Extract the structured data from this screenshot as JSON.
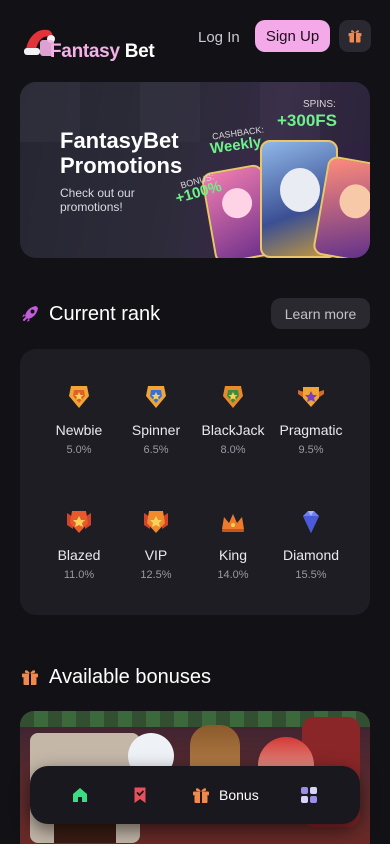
{
  "header": {
    "logo": {
      "part1": "Fantasy",
      "part2": "Bet",
      "hat_icon": "santa-hat-icon"
    },
    "login_label": "Log In",
    "signup_label": "Sign Up",
    "gift_icon": "gift-icon"
  },
  "promo": {
    "title": "FantasyBet Promotions",
    "subtitle": "Check out our promotions!",
    "spins_label": "SPINS:",
    "spins_value": "+300FS",
    "cashback_label": "CASHBACK:",
    "cashback_value": "Weekly",
    "bonus_label": "BONUS:",
    "bonus_value": "+100%"
  },
  "rank": {
    "title": "Current rank",
    "learn_more_label": "Learn more",
    "icon": "rocket-icon",
    "items": [
      {
        "name": "Newbie",
        "pct": "5.0%",
        "icon": "newbie-badge-icon",
        "color": "#f0a534"
      },
      {
        "name": "Spinner",
        "pct": "6.5%",
        "icon": "spinner-badge-icon",
        "color": "#f0a534"
      },
      {
        "name": "BlackJack",
        "pct": "8.0%",
        "icon": "blackjack-badge-icon",
        "color": "#e98a2a"
      },
      {
        "name": "Pragmatic",
        "pct": "9.5%",
        "icon": "pragmatic-badge-icon",
        "color": "#f0a534"
      },
      {
        "name": "Blazed",
        "pct": "11.0%",
        "icon": "blazed-badge-icon",
        "color": "#e85a2c"
      },
      {
        "name": "VIP",
        "pct": "12.5%",
        "icon": "vip-badge-icon",
        "color": "#f08a2c"
      },
      {
        "name": "King",
        "pct": "14.0%",
        "icon": "crown-icon",
        "color": "#f07a2c"
      },
      {
        "name": "Diamond",
        "pct": "15.5%",
        "icon": "diamond-icon",
        "color": "#6f7ff0"
      }
    ]
  },
  "bonuses": {
    "title": "Available bonuses",
    "icon": "gift-icon"
  },
  "bottom_nav": {
    "home_icon": "home-icon",
    "bookmark_icon": "bookmark-icon",
    "bonus_label": "Bonus",
    "bonus_icon": "gift-icon",
    "grid_icon": "grid-icon"
  },
  "colors": {
    "background": "#121116",
    "accent_pink": "#f4a9e8",
    "promo_green": "#6ef08a",
    "home_green": "#3ddc84",
    "bookmark_red": "#e8505b"
  }
}
